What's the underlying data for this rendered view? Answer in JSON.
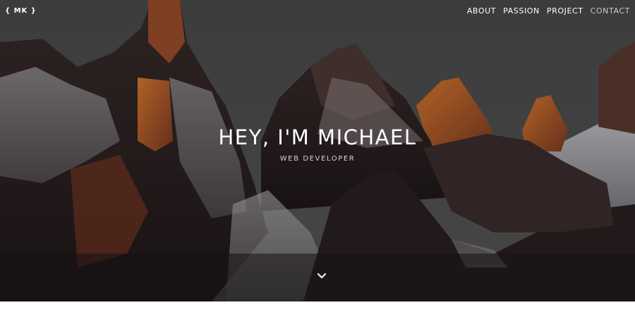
{
  "logo": {
    "text": "{ MK }"
  },
  "nav": {
    "items": [
      {
        "label": "ABOUT",
        "active": false
      },
      {
        "label": "PASSION",
        "active": false
      },
      {
        "label": "PROJECT",
        "active": false
      },
      {
        "label": "CONTACT",
        "active": true
      }
    ]
  },
  "hero": {
    "title": "HEY, I'M MICHAEL",
    "subtitle": "WEB DEVELOPER",
    "scroll_icon": "chevron-down-icon",
    "background": "mountain-peaks-photo"
  },
  "colors": {
    "sky": "#4e4e4e",
    "rock_dark": "#2a2020",
    "rock_lit": "#c0642a",
    "snow": "#b9b9bd",
    "text": "#ffffff",
    "nav_active": "#c9c9c9"
  }
}
